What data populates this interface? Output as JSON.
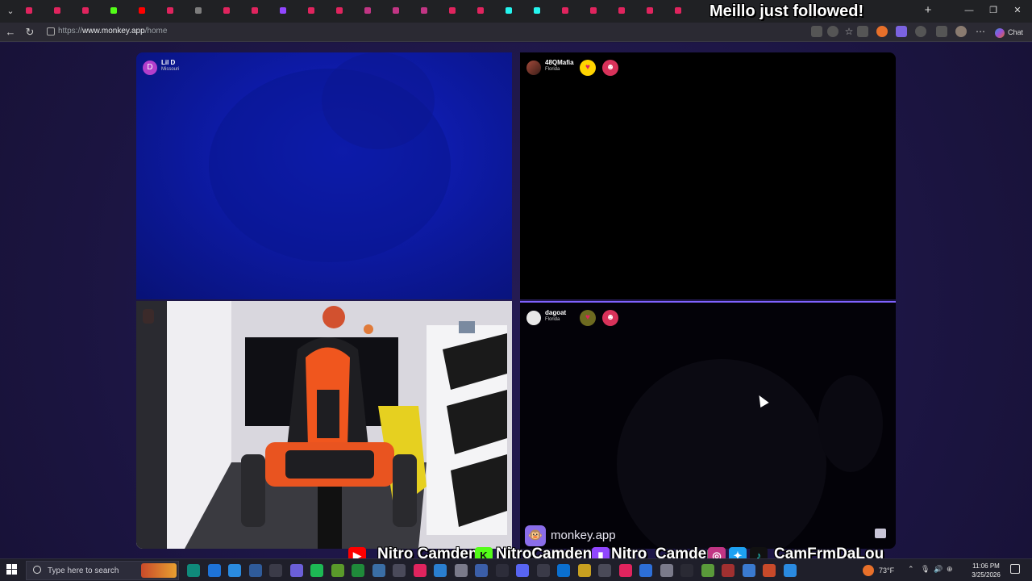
{
  "browser": {
    "url_prefix": "https://",
    "url_host": "www.monkey.app",
    "url_path": "/home",
    "chat_label": "Chat",
    "new_tab_symbol": "+",
    "tab_icons": [
      "#e0245e",
      "#e0245e",
      "#e0245e",
      "#53fc18",
      "#ff0000",
      "#e0245e",
      "#7d7d7d",
      "#e0245e",
      "#e0245e",
      "#9146ff",
      "#e0245e",
      "#e0245e",
      "#c13584",
      "#c13584",
      "#c13584",
      "#e0245e",
      "#e0245e",
      "#25f4ee",
      "#25f4ee",
      "#e0245e",
      "#e0245e",
      "#e0245e",
      "#e0245e",
      "#e0245e"
    ]
  },
  "overlay": {
    "follow_alert": "Meillo just followed!",
    "socials": [
      {
        "platform": "youtube",
        "icon": "youtube-icon",
        "handle": "Nitro Camden",
        "color": "#ff0000"
      },
      {
        "platform": "kick",
        "icon": "kick-icon",
        "handle": "NitroCamden",
        "color": "#53fc18"
      },
      {
        "platform": "twitch",
        "icon": "twitch-icon",
        "handle": "Nitro_Camden",
        "color": "#9146ff"
      },
      {
        "platform": "social",
        "icon": "instagram-twitter-tiktok-icons",
        "handle": "CamFrmDaLou",
        "color": "#c13584"
      }
    ]
  },
  "monkey": {
    "brand": "monkey.app",
    "tiles": [
      {
        "id": "top-left",
        "name": "Lil D",
        "location": "Missouri",
        "avatar_letter": "D",
        "avatar_color": "#b33ecb"
      },
      {
        "id": "top-right",
        "name": "48QMafia",
        "location": "Florida",
        "badges": [
          "heart-badge",
          "character-badge"
        ]
      },
      {
        "id": "bottom-left",
        "name": "",
        "location": "",
        "webcam": "room-with-gaming-chair"
      },
      {
        "id": "bottom-right",
        "name": "dagoat",
        "location": "Florida",
        "badges": [
          "heart-badge",
          "character-badge"
        ]
      }
    ]
  },
  "taskbar": {
    "search_placeholder": "Type here to search",
    "temperature": "73°F",
    "time": "11:06 PM",
    "date": "3/25/2026"
  }
}
